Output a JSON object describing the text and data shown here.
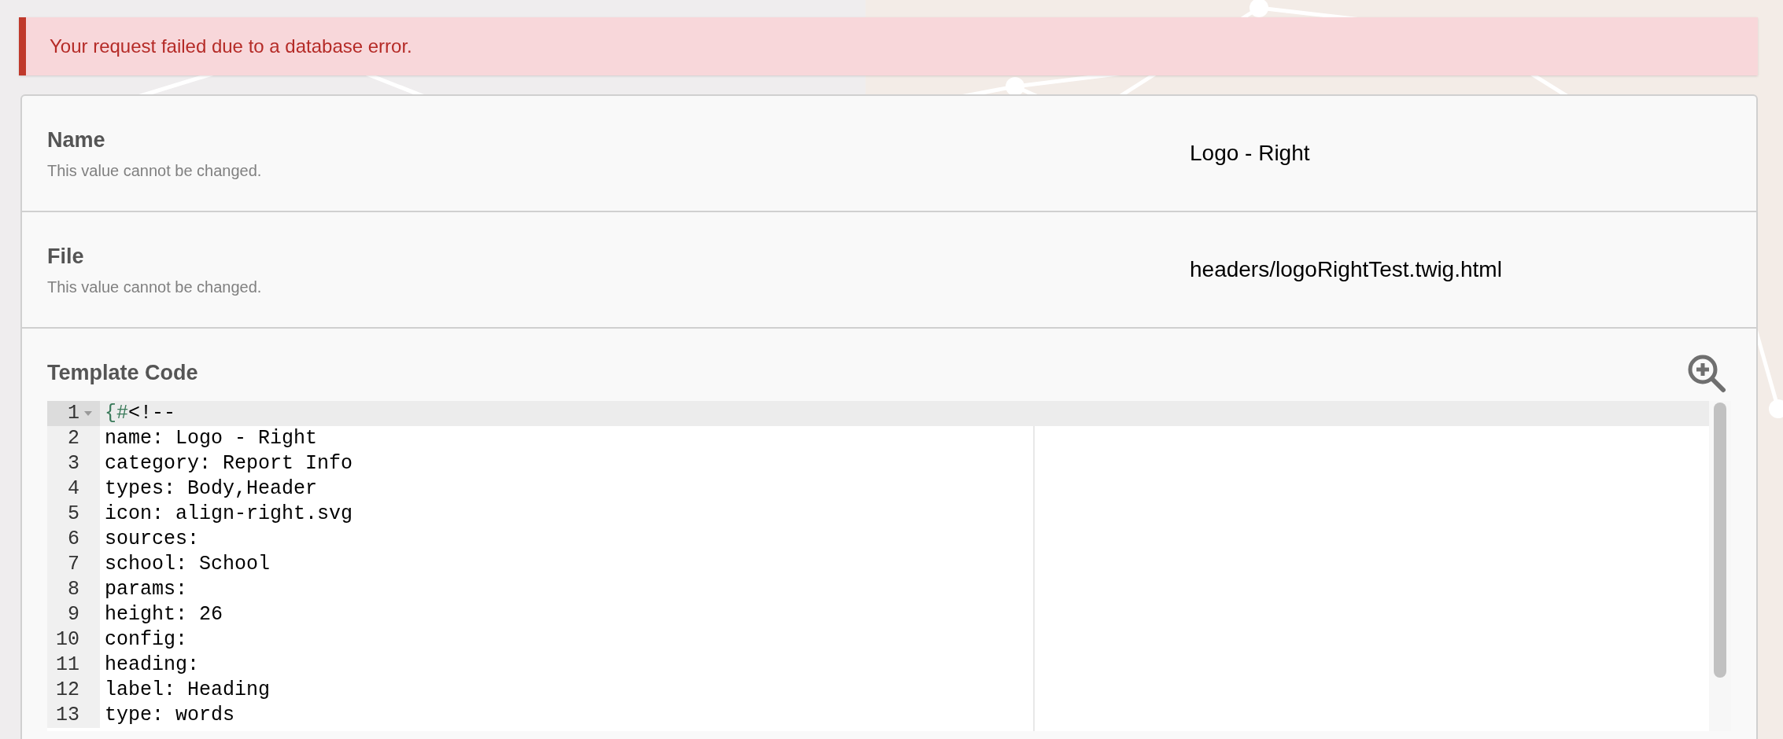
{
  "alert": {
    "message": "Your request failed due to a database error."
  },
  "fields": [
    {
      "label": "Name",
      "help": "This value cannot be changed.",
      "value": "Logo - Right"
    },
    {
      "label": "File",
      "help": "This value cannot be changed.",
      "value": "headers/logoRightTest.twig.html"
    }
  ],
  "template": {
    "label": "Template Code",
    "lines": [
      {
        "number": "1",
        "active": true,
        "foldable": true,
        "tokens": [
          {
            "kind": "twig",
            "text": "{#"
          },
          {
            "kind": "plain",
            "text": "<!--"
          }
        ]
      },
      {
        "number": "2",
        "active": false,
        "foldable": false,
        "tokens": [
          {
            "kind": "plain",
            "text": "name: Logo - Right"
          }
        ]
      },
      {
        "number": "3",
        "active": false,
        "foldable": false,
        "tokens": [
          {
            "kind": "plain",
            "text": "category: Report Info"
          }
        ]
      },
      {
        "number": "4",
        "active": false,
        "foldable": false,
        "tokens": [
          {
            "kind": "plain",
            "text": "types: Body,Header"
          }
        ]
      },
      {
        "number": "5",
        "active": false,
        "foldable": false,
        "tokens": [
          {
            "kind": "plain",
            "text": "icon: align-right.svg"
          }
        ]
      },
      {
        "number": "6",
        "active": false,
        "foldable": false,
        "tokens": [
          {
            "kind": "plain",
            "text": "sources:"
          }
        ]
      },
      {
        "number": "7",
        "active": false,
        "foldable": false,
        "tokens": [
          {
            "kind": "plain",
            "text": "school: School"
          }
        ]
      },
      {
        "number": "8",
        "active": false,
        "foldable": false,
        "tokens": [
          {
            "kind": "plain",
            "text": "params:"
          }
        ]
      },
      {
        "number": "9",
        "active": false,
        "foldable": false,
        "tokens": [
          {
            "kind": "plain",
            "text": "height: 26"
          }
        ]
      },
      {
        "number": "10",
        "active": false,
        "foldable": false,
        "tokens": [
          {
            "kind": "plain",
            "text": "config:"
          }
        ]
      },
      {
        "number": "11",
        "active": false,
        "foldable": false,
        "tokens": [
          {
            "kind": "plain",
            "text": "heading:"
          }
        ]
      },
      {
        "number": "12",
        "active": false,
        "foldable": false,
        "tokens": [
          {
            "kind": "plain",
            "text": "label: Heading"
          }
        ]
      },
      {
        "number": "13",
        "active": false,
        "foldable": false,
        "tokens": [
          {
            "kind": "plain",
            "text": "type: words"
          }
        ]
      }
    ]
  }
}
